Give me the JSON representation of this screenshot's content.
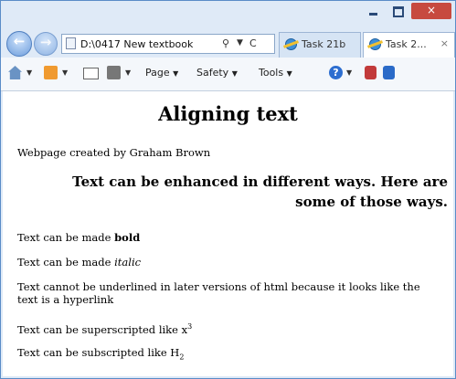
{
  "browser": {
    "address_url": "D:\\0417 New textbook",
    "tabs": [
      {
        "label": "Task 21b"
      },
      {
        "label": "Task 2...",
        "close": "×"
      }
    ],
    "glyphs": {
      "back": "←",
      "forward": "→",
      "search": "⚲",
      "dropdown": "▼",
      "refresh": "C",
      "close_window": "×",
      "help": "?"
    }
  },
  "toolbar": {
    "page_label": "Page",
    "safety_label": "Safety",
    "tools_label": "Tools",
    "arrow": "▼"
  },
  "page": {
    "heading": "Aligning text",
    "byline": "Webpage created by Graham Brown",
    "subheading": "Text can be enhanced in different ways. Here are some of those ways.",
    "bold_prefix": "Text can be made ",
    "bold_word": "bold",
    "italic_prefix": "Text can be made ",
    "italic_word": "italic",
    "underline_text": "Text cannot be underlined in later versions of html because it looks like the text is a hyperlink",
    "super_prefix": "Text can be superscripted like x",
    "super_mark": "3",
    "sub_prefix": "Text can be subscripted like H",
    "sub_mark": "2"
  },
  "colors": {
    "frame": "#dfeaf7",
    "close_button": "#c74a3f",
    "tab_active": "#ffffff"
  },
  "icons": [
    "back-arrow-icon",
    "forward-arrow-icon",
    "page-icon",
    "search-icon",
    "refresh-icon",
    "ie-icon",
    "home-icon",
    "feed-icon",
    "mail-icon",
    "print-icon",
    "help-icon",
    "research-icon",
    "translate-icon"
  ]
}
